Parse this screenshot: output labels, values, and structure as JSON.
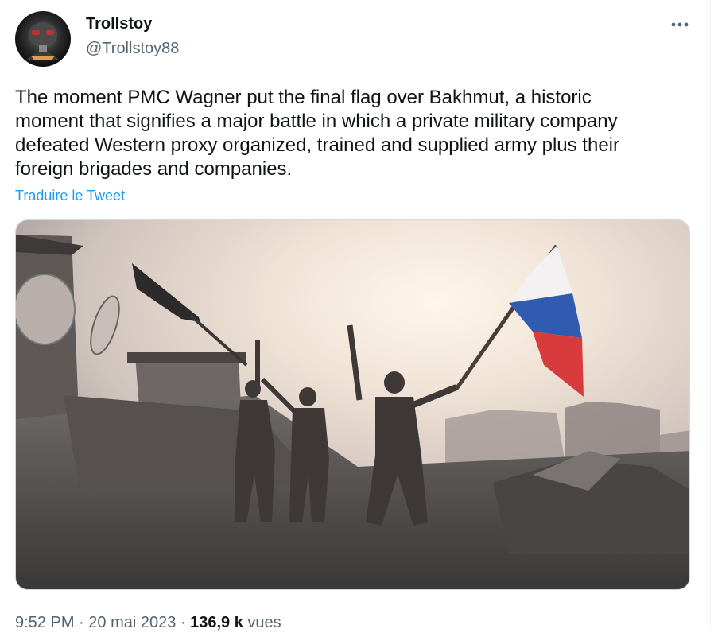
{
  "author": {
    "display_name": "Trollstoy",
    "handle": "@Trollstoy88"
  },
  "tweet": {
    "text": "The moment PMC Wagner put the final flag over Bakhmut, a historic\nmoment that signifies a major battle in which a private military company\ndefeated Western proxy organized, trained and supplied army plus their\nforeign brigades and companies.",
    "translate_label": "Traduire le Tweet"
  },
  "meta": {
    "time": "9:52 PM",
    "sep1": " · ",
    "date": "20 mai 2023",
    "sep2": " · ",
    "views_count": "136,9 k",
    "views_label": " vues"
  },
  "icons": {
    "more": "more-horizontal-icon"
  },
  "colors": {
    "link": "#1d9bf0",
    "secondary_text": "#536471",
    "text": "#0f1419",
    "flag_white": "#f4f1f2",
    "flag_blue": "#2f5bb0",
    "flag_red": "#d83b3b"
  }
}
